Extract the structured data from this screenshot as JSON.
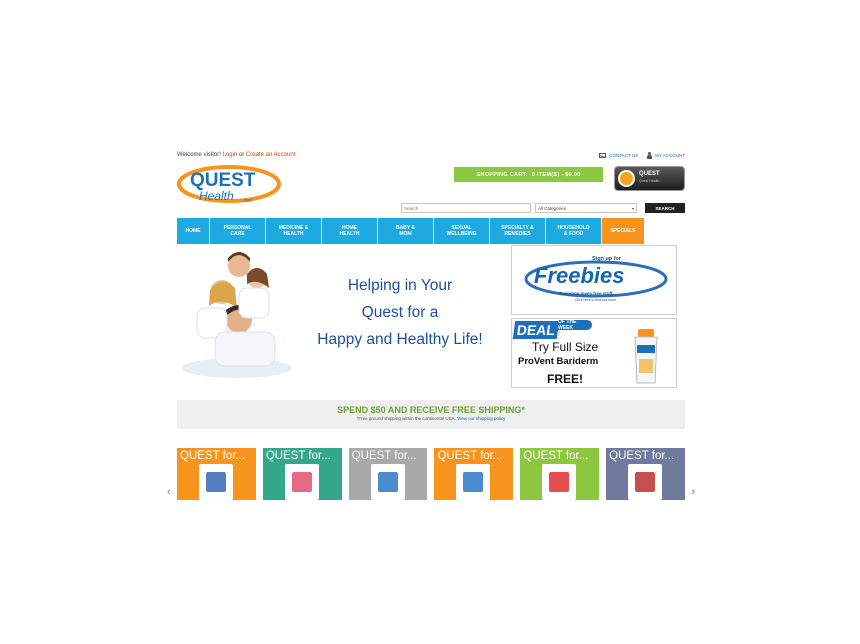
{
  "topbar": {
    "welcome_prefix": "Welcome visitor!",
    "login": "Login",
    "or": "or",
    "create_account": "Create an Account",
    "contact_us": "CONTACT US",
    "my_account": "MY ACCOUNT"
  },
  "logo": {
    "word1": "QUEST",
    "word2": "Health",
    "suffix": ".net"
  },
  "cart": {
    "label": "SHOPPING CART:",
    "items": "0 ITEM(S) - $0.00"
  },
  "badge": {
    "title": "QUEST",
    "subtitle": "Quest Health"
  },
  "search": {
    "placeholder": "Search",
    "category_selected": "All Categories",
    "button": "SEARCH"
  },
  "nav": {
    "items": [
      {
        "label": "HOME"
      },
      {
        "label": "PERSONAL\nCARE"
      },
      {
        "label": "MEDICINE &\nHEALTH"
      },
      {
        "label": "HOME\nHEALTH"
      },
      {
        "label": "BABY &\nMOM"
      },
      {
        "label": "SEXUAL\nWELLBEING"
      },
      {
        "label": "SPECIALTY &\nREMEDIES"
      },
      {
        "label": "HOUSEHOLD\n& FOOD"
      },
      {
        "label": "SPECIALS"
      }
    ]
  },
  "hero": {
    "line1": "Helping in Your",
    "line2": "Quest for a",
    "line3": "Happy and Healthy Life!"
  },
  "freebies": {
    "signup": "Sign up for",
    "word": "Freebies",
    "sub1": "Everyone loves free stuff",
    "sub2": "Click here to find out more"
  },
  "deal": {
    "deal": "DEAL",
    "of_the_week": "OF THE WEEK",
    "line1": "Try Full Size",
    "line2": "ProVent Bariderm",
    "line3": "FREE!"
  },
  "shipping": {
    "headline": "SPEND $50 AND RECEIVE FREE SHIPPING*",
    "note": "*Free ground shipping within the continental USA.",
    "link": "View our shipping policy"
  },
  "carousel": {
    "left_arrow": "‹",
    "right_arrow": "›",
    "tiles": [
      {
        "label": "QUEST for...",
        "color": "#f7941d",
        "product_color": "#2a5db0"
      },
      {
        "label": "QUEST for...",
        "color": "#35a88b",
        "product_color": "#e0446a"
      },
      {
        "label": "QUEST for...",
        "color": "#a9a9a9",
        "product_color": "#1e6fc2"
      },
      {
        "label": "QUEST for...",
        "color": "#f7941d",
        "product_color": "#1e6fc2"
      },
      {
        "label": "QUEST for...",
        "color": "#8dc63f",
        "product_color": "#d22"
      },
      {
        "label": "QUEST for...",
        "color": "#6f7a9e",
        "product_color": "#b22"
      }
    ]
  },
  "colors": {
    "nav_blue": "#1fa9e1",
    "special_orange": "#f7941d",
    "cart_green": "#8dc63f",
    "link_orange": "#d9400b"
  }
}
